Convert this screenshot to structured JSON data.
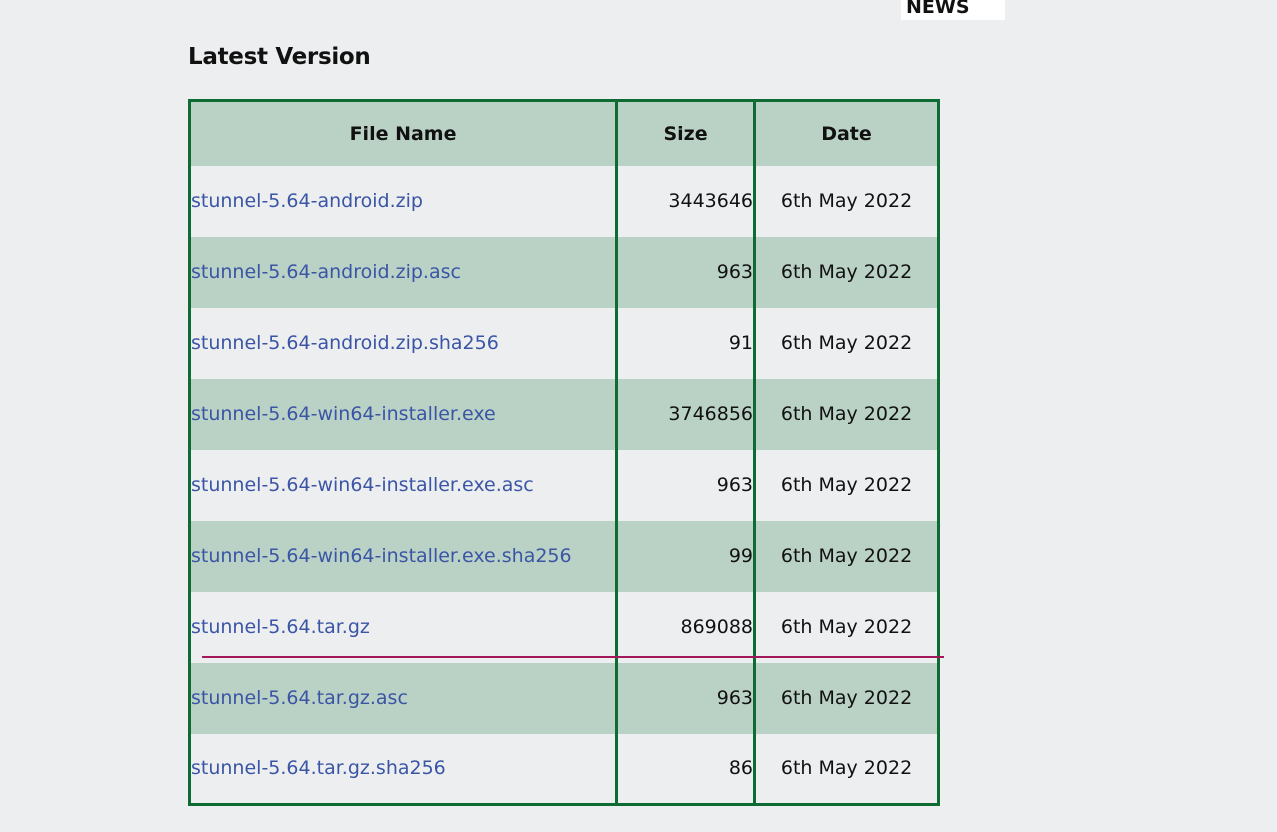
{
  "nav": {
    "news_label": "NEWS"
  },
  "section": {
    "title": "Latest Version"
  },
  "table": {
    "headers": {
      "file_name": "File Name",
      "size": "Size",
      "date": "Date"
    },
    "rows": [
      {
        "name": "stunnel-5.64-android.zip",
        "size": "3443646",
        "date": "6th May 2022"
      },
      {
        "name": "stunnel-5.64-android.zip.asc",
        "size": "963",
        "date": "6th May 2022"
      },
      {
        "name": "stunnel-5.64-android.zip.sha256",
        "size": "91",
        "date": "6th May 2022"
      },
      {
        "name": "stunnel-5.64-win64-installer.exe",
        "size": "3746856",
        "date": "6th May 2022"
      },
      {
        "name": "stunnel-5.64-win64-installer.exe.asc",
        "size": "963",
        "date": "6th May 2022"
      },
      {
        "name": "stunnel-5.64-win64-installer.exe.sha256",
        "size": "99",
        "date": "6th May 2022"
      },
      {
        "name": "stunnel-5.64.tar.gz",
        "size": "869088",
        "date": "6th May 2022"
      },
      {
        "name": "stunnel-5.64.tar.gz.asc",
        "size": "963",
        "date": "6th May 2022"
      },
      {
        "name": "stunnel-5.64.tar.gz.sha256",
        "size": "86",
        "date": "6th May 2022"
      }
    ]
  },
  "colors": {
    "accent_green": "#0e6b33",
    "row_tint": "#bad1c5",
    "link": "#3a55a5",
    "annotation_line": "#a3185a"
  }
}
